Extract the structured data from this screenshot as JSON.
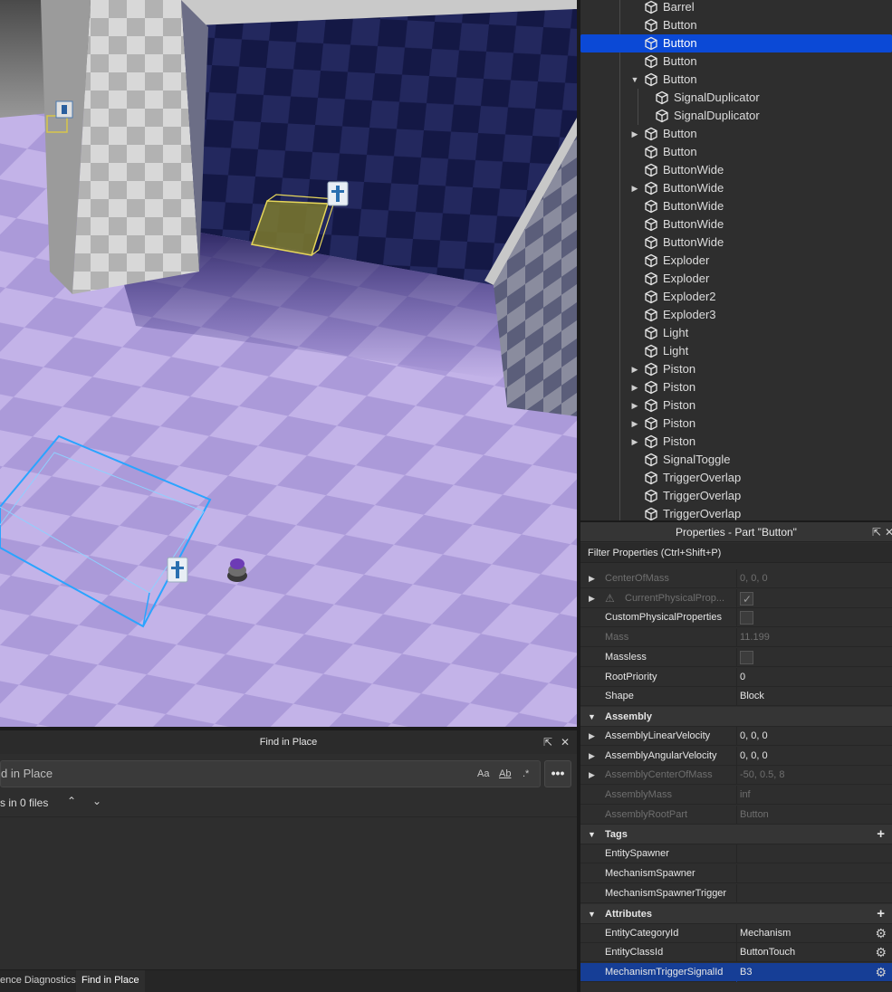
{
  "explorer": {
    "items": [
      {
        "label": "Barrel",
        "expand": "none",
        "depth": 0
      },
      {
        "label": "Button",
        "expand": "none",
        "depth": 0
      },
      {
        "label": "Button",
        "expand": "none",
        "depth": 0,
        "selected": true
      },
      {
        "label": "Button",
        "expand": "none",
        "depth": 0
      },
      {
        "label": "Button",
        "expand": "expanded",
        "depth": 0
      },
      {
        "label": "SignalDuplicator",
        "expand": "none",
        "depth": 1
      },
      {
        "label": "SignalDuplicator",
        "expand": "none",
        "depth": 1
      },
      {
        "label": "Button",
        "expand": "collapsed",
        "depth": 0
      },
      {
        "label": "Button",
        "expand": "none",
        "depth": 0
      },
      {
        "label": "ButtonWide",
        "expand": "none",
        "depth": 0
      },
      {
        "label": "ButtonWide",
        "expand": "collapsed",
        "depth": 0
      },
      {
        "label": "ButtonWide",
        "expand": "none",
        "depth": 0
      },
      {
        "label": "ButtonWide",
        "expand": "none",
        "depth": 0
      },
      {
        "label": "ButtonWide",
        "expand": "none",
        "depth": 0
      },
      {
        "label": "Exploder",
        "expand": "none",
        "depth": 0
      },
      {
        "label": "Exploder",
        "expand": "none",
        "depth": 0
      },
      {
        "label": "Exploder2",
        "expand": "none",
        "depth": 0
      },
      {
        "label": "Exploder3",
        "expand": "none",
        "depth": 0
      },
      {
        "label": "Light",
        "expand": "none",
        "depth": 0
      },
      {
        "label": "Light",
        "expand": "none",
        "depth": 0
      },
      {
        "label": "Piston",
        "expand": "collapsed",
        "depth": 0
      },
      {
        "label": "Piston",
        "expand": "collapsed",
        "depth": 0
      },
      {
        "label": "Piston",
        "expand": "collapsed",
        "depth": 0
      },
      {
        "label": "Piston",
        "expand": "collapsed",
        "depth": 0
      },
      {
        "label": "Piston",
        "expand": "collapsed",
        "depth": 0
      },
      {
        "label": "SignalToggle",
        "expand": "none",
        "depth": 0
      },
      {
        "label": "TriggerOverlap",
        "expand": "none",
        "depth": 0
      },
      {
        "label": "TriggerOverlap",
        "expand": "none",
        "depth": 0
      },
      {
        "label": "TriggerOverlap",
        "expand": "none",
        "depth": 0
      }
    ]
  },
  "properties": {
    "title": "Properties - Part \"Button\"",
    "filter_placeholder": "Filter Properties (Ctrl+Shift+P)",
    "rows": [
      {
        "kind": "prop",
        "name": "CenterOfMass",
        "value": "0, 0, 0",
        "dim": true,
        "arrow": true
      },
      {
        "kind": "prop",
        "name": "CurrentPhysicalProp...",
        "value": "",
        "dim": true,
        "arrow": true,
        "warn": true,
        "checkbox": "checked"
      },
      {
        "kind": "prop",
        "name": "CustomPhysicalProperties",
        "value": "",
        "checkbox": "empty"
      },
      {
        "kind": "prop",
        "name": "Mass",
        "value": "11.199",
        "dim": true
      },
      {
        "kind": "prop",
        "name": "Massless",
        "value": "",
        "checkbox": "empty"
      },
      {
        "kind": "prop",
        "name": "RootPriority",
        "value": "0"
      },
      {
        "kind": "prop",
        "name": "Shape",
        "value": "Block"
      },
      {
        "kind": "cat",
        "name": "Assembly"
      },
      {
        "kind": "prop",
        "name": "AssemblyLinearVelocity",
        "value": "0, 0, 0",
        "arrow": true
      },
      {
        "kind": "prop",
        "name": "AssemblyAngularVelocity",
        "value": "0, 0, 0",
        "arrow": true
      },
      {
        "kind": "prop",
        "name": "AssemblyCenterOfMass",
        "value": "-50, 0.5, 8",
        "dim": true,
        "arrow": true
      },
      {
        "kind": "prop",
        "name": "AssemblyMass",
        "value": "inf",
        "dim": true
      },
      {
        "kind": "prop",
        "name": "AssemblyRootPart",
        "value": "Button",
        "dim": true
      },
      {
        "kind": "cat",
        "name": "Tags",
        "plus": true
      },
      {
        "kind": "prop",
        "name": "EntitySpawner",
        "value": ""
      },
      {
        "kind": "prop",
        "name": "MechanismSpawner",
        "value": ""
      },
      {
        "kind": "prop",
        "name": "MechanismSpawnerTrigger",
        "value": ""
      },
      {
        "kind": "cat",
        "name": "Attributes",
        "plus": true
      },
      {
        "kind": "prop",
        "name": "EntityCategoryId",
        "value": "Mechanism",
        "gear": true
      },
      {
        "kind": "prop",
        "name": "EntityClassId",
        "value": "ButtonTouch",
        "gear": true
      },
      {
        "kind": "prop",
        "name": "MechanismTriggerSignalId",
        "value": "B3",
        "gear": true,
        "selected": true
      }
    ]
  },
  "find": {
    "title": "Find in Place",
    "input_value": "d in Place",
    "opt_case": "Aa",
    "opt_word": "Ab",
    "opt_regex": ".*",
    "more": "•••",
    "results": "s in 0 files",
    "prev": "⌃",
    "next": "⌄"
  },
  "tabs": [
    {
      "label": "ence Diagnostics",
      "active": false
    },
    {
      "label": "Find in Place",
      "active": true
    }
  ],
  "colors": {
    "selection": "#0b49d6",
    "floor_light": "#c4b5e8",
    "floor_dark": "#a896d6",
    "wall_dark": "#1d2050",
    "selection_box": "#2aa4ff",
    "highlight_box": "#b8a93a"
  }
}
